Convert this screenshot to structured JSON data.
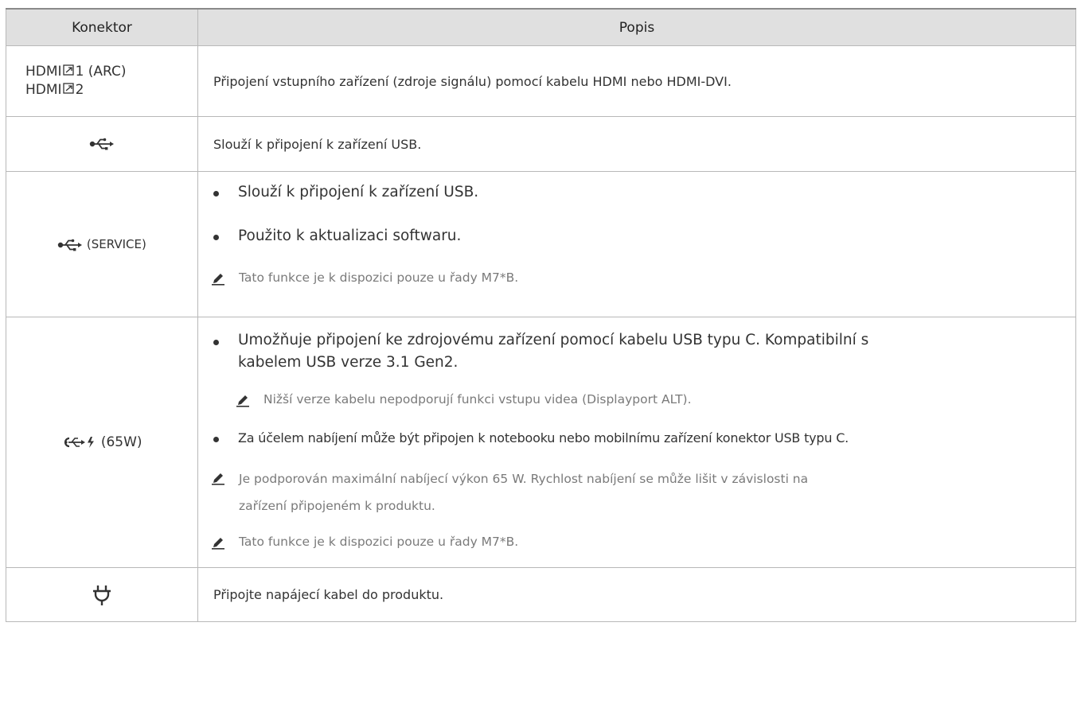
{
  "table": {
    "headers": [
      "Konektor",
      "Popis"
    ],
    "rows": [
      {
        "connector": "HDMI 1 (ARC)",
        "connector_line2": "HDMI 2",
        "description": "Připojení vstupního zařízení (zdroje signálu) pomocí kabelu HDMI nebo HDMI-DVI."
      },
      {
        "connector_icon": "usb-icon",
        "description": "Slouží k připojení k zařízení USB."
      },
      {
        "connector_icon": "usb-icon",
        "connector_suffix": "(SERVICE)",
        "bullets": [
          "Slouží k připojení k zařízení USB.",
          "Použito k aktualizaci softwaru."
        ],
        "note": "Tato funkce je k dispozici pouze u řady M7*B."
      },
      {
        "connector_icon": "usb-c-charge-icon",
        "connector_suffix": "(65W)",
        "bullet1_line1": "Umožňuje připojení ke zdrojovému zařízení pomocí kabelu USB typu C. Kompatibilní s",
        "bullet1_line2": "kabelem USB verze 3.1 Gen2.",
        "subnote": "Nižší verze kabelu nepodporují funkci vstupu videa (Displayport ALT).",
        "bullet2": "Za účelem nabíjení může být připojen k notebooku nebo mobilnímu zařízení konektor USB typu C.",
        "note1_line1": "Je podporován maximální nabíjecí výkon 65 W. Rychlost nabíjení se může lišit v závislosti na",
        "note1_line2": "zařízení připojeném k produktu.",
        "note2": "Tato funkce je k dispozici pouze u řady M7*B."
      },
      {
        "connector_icon": "power-plug-icon",
        "description": "Připojte napájecí kabel do produktu."
      }
    ]
  },
  "colors": {
    "header_bg": "#e0e0e0",
    "text": "#333333",
    "note": "#7a7a7a",
    "border": "#b8b8b8"
  }
}
